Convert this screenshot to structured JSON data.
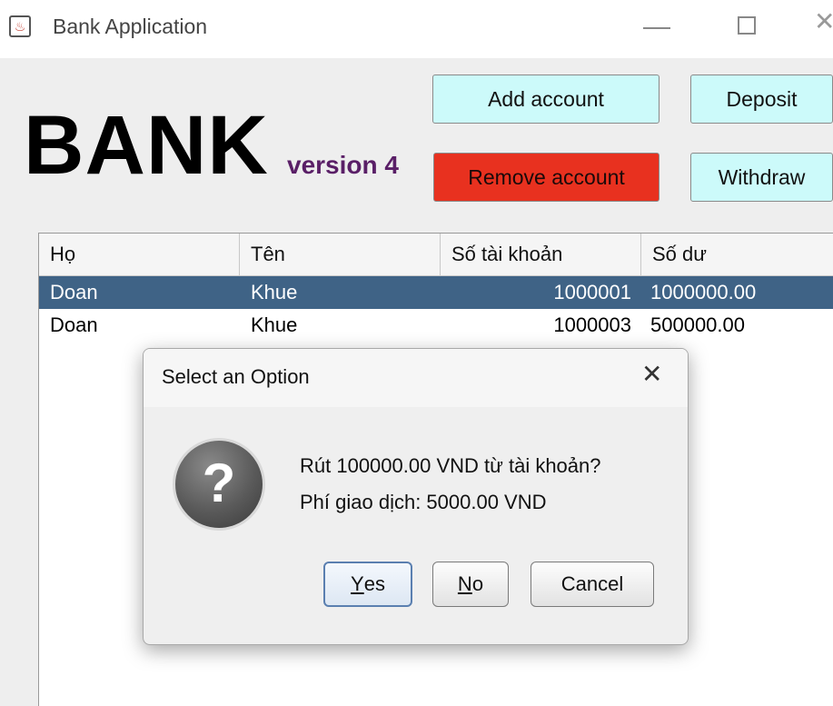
{
  "window": {
    "title": "Bank Application",
    "icon": "java-cup-icon",
    "controls": {
      "minimize": "—",
      "maximize": "☐",
      "close": "✕"
    }
  },
  "logo": {
    "main": "BANK",
    "version": "version 4"
  },
  "toolbar": {
    "add_label": "Add account",
    "remove_label": "Remove account",
    "deposit_label": "Deposit",
    "withdraw_label": "Withdraw"
  },
  "table": {
    "columns": [
      "Họ",
      "Tên",
      "Số tài khoản",
      "Số dư"
    ],
    "rows": [
      {
        "ho": "Doan",
        "ten": "Khue",
        "account": "1000001",
        "balance": "1000000.00",
        "selected": true
      },
      {
        "ho": "Doan",
        "ten": "Khue",
        "account": "1000003",
        "balance": "500000.00",
        "selected": false
      }
    ]
  },
  "dialog": {
    "title": "Select an Option",
    "icon": "question-icon",
    "message_line1": "Rút 100000.00 VND từ tài khoản?",
    "message_line2": "Phí giao dịch: 5000.00 VND",
    "yes_mnemonic": "Y",
    "yes_rest": "es",
    "no_mnemonic": "N",
    "no_rest": "o",
    "cancel_label": "Cancel"
  },
  "colors": {
    "accent_cyan": "#ccfafa",
    "danger_red": "#e8311f",
    "selected_row": "#3f6386",
    "version_purple": "#5a1f67"
  }
}
